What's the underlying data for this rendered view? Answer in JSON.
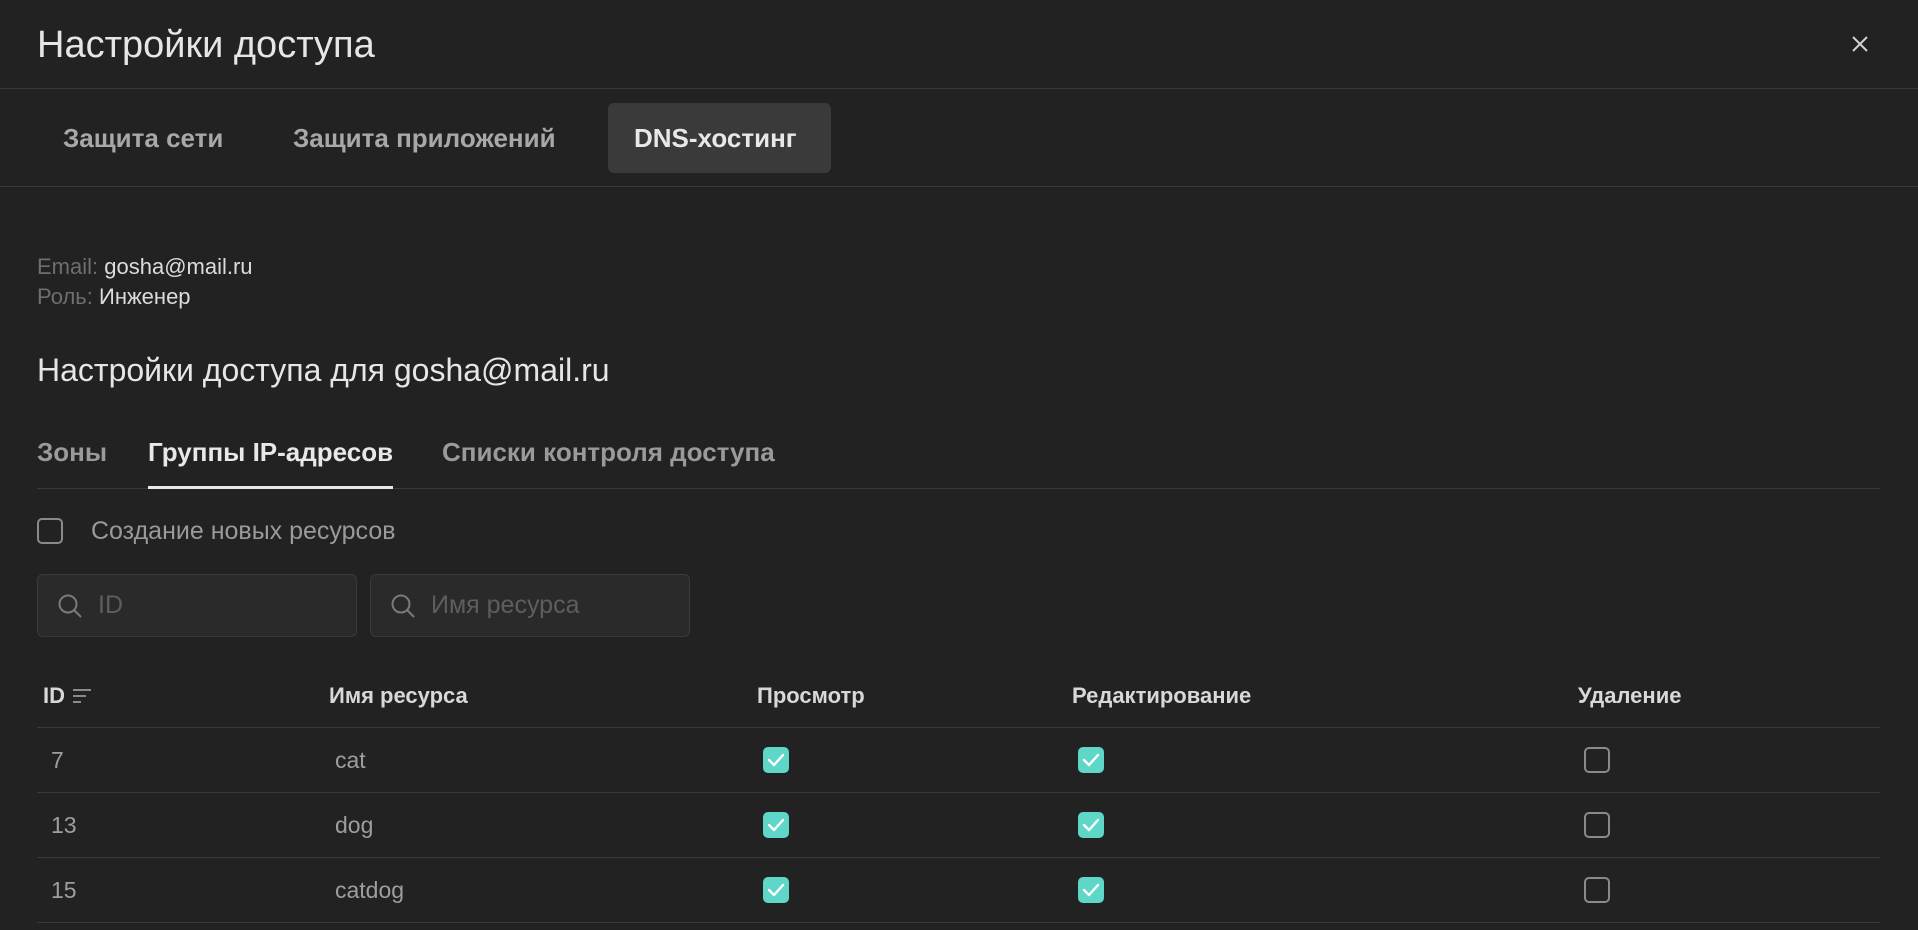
{
  "modal": {
    "title": "Настройки доступа"
  },
  "top_tabs": [
    {
      "label": "Защита сети",
      "active": false
    },
    {
      "label": "Защита приложений",
      "active": false
    },
    {
      "label": "DNS-хостинг",
      "active": true
    }
  ],
  "user": {
    "email_label": "Email:",
    "email": "gosha@mail.ru",
    "role_label": "Роль:",
    "role": "Инженер"
  },
  "section": {
    "title": "Настройки доступа для gosha@mail.ru"
  },
  "sub_tabs": [
    {
      "label": "Зоны",
      "active": false
    },
    {
      "label": "Группы IP-адресов",
      "active": true
    },
    {
      "label": "Списки контроля доступа",
      "active": false
    }
  ],
  "create_resources": {
    "label": "Создание новых ресурсов",
    "checked": false
  },
  "search": {
    "id_placeholder": "ID",
    "name_placeholder": "Имя ресурса"
  },
  "table": {
    "headers": {
      "id": "ID",
      "name": "Имя ресурса",
      "view": "Просмотр",
      "edit": "Редактирование",
      "delete": "Удаление"
    },
    "rows": [
      {
        "id": "7",
        "name": "cat",
        "view": true,
        "edit": true,
        "delete": false
      },
      {
        "id": "13",
        "name": "dog",
        "view": true,
        "edit": true,
        "delete": false
      },
      {
        "id": "15",
        "name": "catdog",
        "view": true,
        "edit": true,
        "delete": false
      }
    ]
  },
  "colors": {
    "background": "#222222",
    "accent_checkbox": "#5ed6c8",
    "active_tab_bg": "#3a3a3a"
  }
}
